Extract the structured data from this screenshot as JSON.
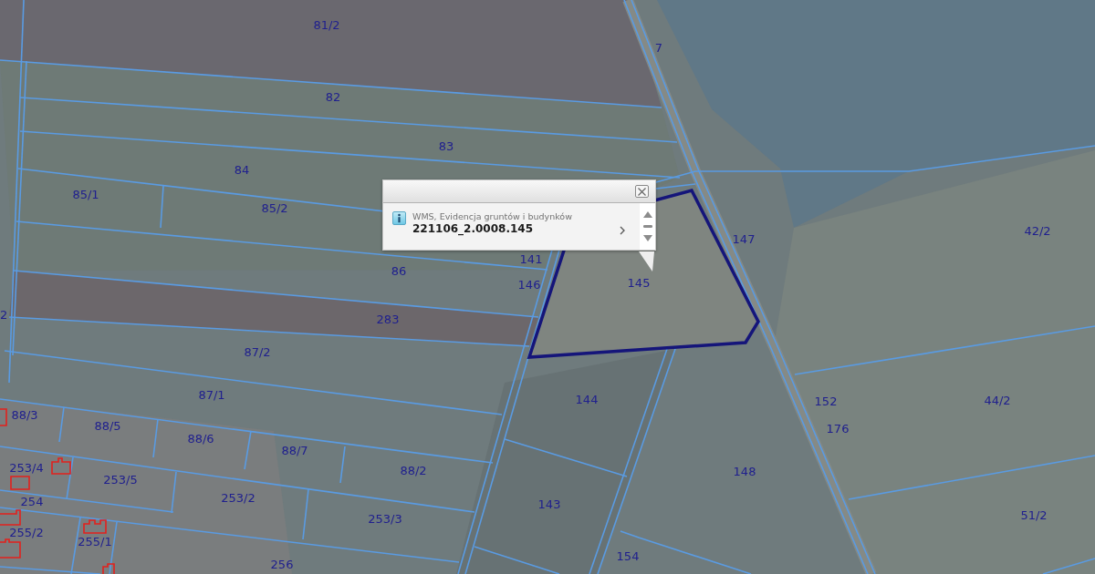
{
  "map": {
    "parcels": [
      {
        "label": "81/2",
        "selected": false
      },
      {
        "label": "7",
        "selected": false
      },
      {
        "label": "82",
        "selected": false
      },
      {
        "label": "83",
        "selected": false
      },
      {
        "label": "84",
        "selected": false
      },
      {
        "label": "85/1",
        "selected": false
      },
      {
        "label": "85/2",
        "selected": false
      },
      {
        "label": "42/2",
        "selected": false
      },
      {
        "label": "147",
        "selected": false
      },
      {
        "label": "141",
        "selected": false
      },
      {
        "label": "86",
        "selected": false
      },
      {
        "label": "145",
        "selected": true
      },
      {
        "label": "146",
        "selected": false
      },
      {
        "label": "2",
        "selected": false
      },
      {
        "label": "283",
        "selected": false
      },
      {
        "label": "87/2",
        "selected": false
      },
      {
        "label": "87/1",
        "selected": false
      },
      {
        "label": "144",
        "selected": false
      },
      {
        "label": "152",
        "selected": false
      },
      {
        "label": "44/2",
        "selected": false
      },
      {
        "label": "88/3",
        "selected": false
      },
      {
        "label": "88/5",
        "selected": false
      },
      {
        "label": "176",
        "selected": false
      },
      {
        "label": "88/6",
        "selected": false
      },
      {
        "label": "88/7",
        "selected": false
      },
      {
        "label": "253/4",
        "selected": false
      },
      {
        "label": "88/2",
        "selected": false
      },
      {
        "label": "148",
        "selected": false
      },
      {
        "label": "253/5",
        "selected": false
      },
      {
        "label": "254",
        "selected": false
      },
      {
        "label": "253/2",
        "selected": false
      },
      {
        "label": "143",
        "selected": false
      },
      {
        "label": "51/2",
        "selected": false
      },
      {
        "label": "253/3",
        "selected": false
      },
      {
        "label": "255/2",
        "selected": false
      },
      {
        "label": "255/1",
        "selected": false
      },
      {
        "label": "154",
        "selected": false
      },
      {
        "label": "256",
        "selected": false
      }
    ]
  },
  "info_popup": {
    "layer": "WMS, Evidencja gruntów i budynków",
    "parcel_id": "221106_2.0008.145"
  }
}
